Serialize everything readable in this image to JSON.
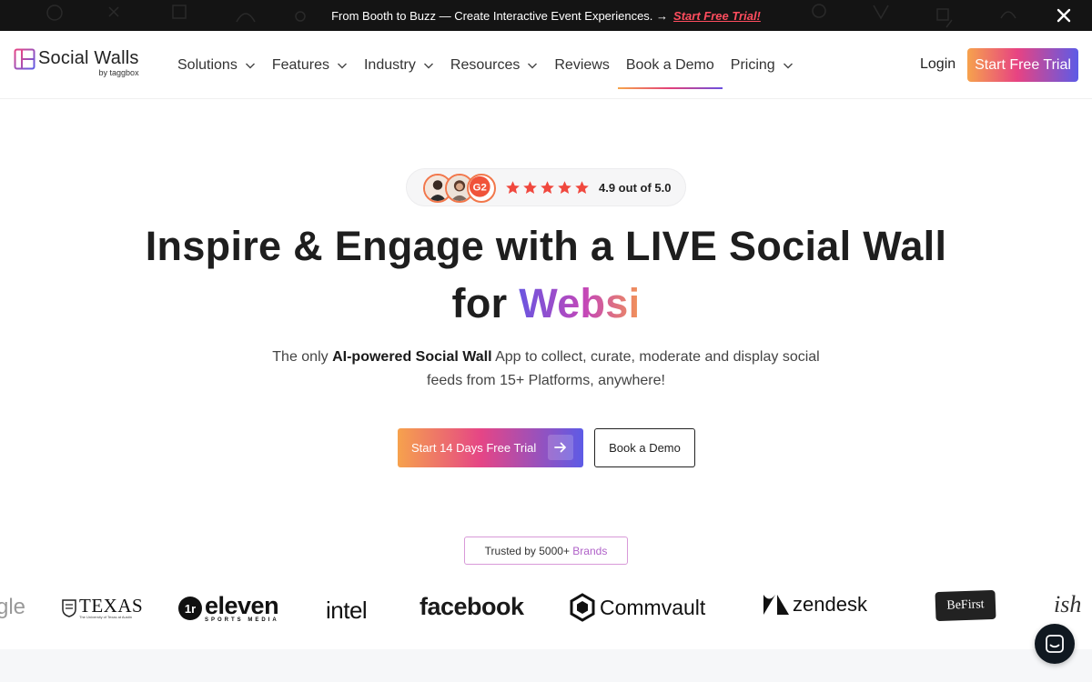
{
  "announcement": {
    "text": "From Booth to Buzz — Create Interactive Event Experiences. →",
    "link": "Start Free Trial!"
  },
  "header": {
    "logo_title": "Social Walls",
    "logo_sub": "by taggbox",
    "nav": [
      {
        "label": "Solutions",
        "dropdown": true
      },
      {
        "label": "Features",
        "dropdown": true
      },
      {
        "label": "Industry",
        "dropdown": true
      },
      {
        "label": "Resources",
        "dropdown": true
      },
      {
        "label": "Reviews",
        "dropdown": false
      },
      {
        "label": "Book a Demo",
        "dropdown": false,
        "active": true
      },
      {
        "label": "Pricing",
        "dropdown": true
      }
    ],
    "login": "Login",
    "cta": "Start Free Trial"
  },
  "rating": {
    "stars": 5,
    "text": "4.9 out of 5.0",
    "badge": "G2"
  },
  "hero": {
    "line1": "Inspire & Engage with a LIVE Social Wall",
    "line2_prefix": "for",
    "line2_highlight": "Websi",
    "sub_line1_pre": "The only",
    "sub_line1_bold": "AI-powered Social Wall",
    "sub_line1_post": "App to collect, curate, moderate and display social",
    "sub_line2": "feeds from 15+ Platforms, anywhere!",
    "cta_primary": "Start 14 Days Free Trial",
    "cta_secondary": "Book a Demo"
  },
  "trusted": {
    "prefix": "Trusted by 5000+",
    "highlight": "Brands"
  },
  "brands": {
    "google_partial": "gle",
    "texas": "TEXAS",
    "texas_sub": "The University of Texas at Austin",
    "eleven": "eleven",
    "eleven_sub": "SPORTS MEDIA",
    "intel": "intel",
    "facebook": "facebook",
    "commvault": "Commvault",
    "zendesk": "zendesk",
    "befirst": "BeFirst",
    "partial": "ish"
  },
  "colors": {
    "accent_orange": "#f6a24d",
    "accent_pink": "#e54586",
    "accent_purple": "#5d5be6",
    "announcement_link": "#ff4d5e",
    "star": "#f0483e"
  }
}
